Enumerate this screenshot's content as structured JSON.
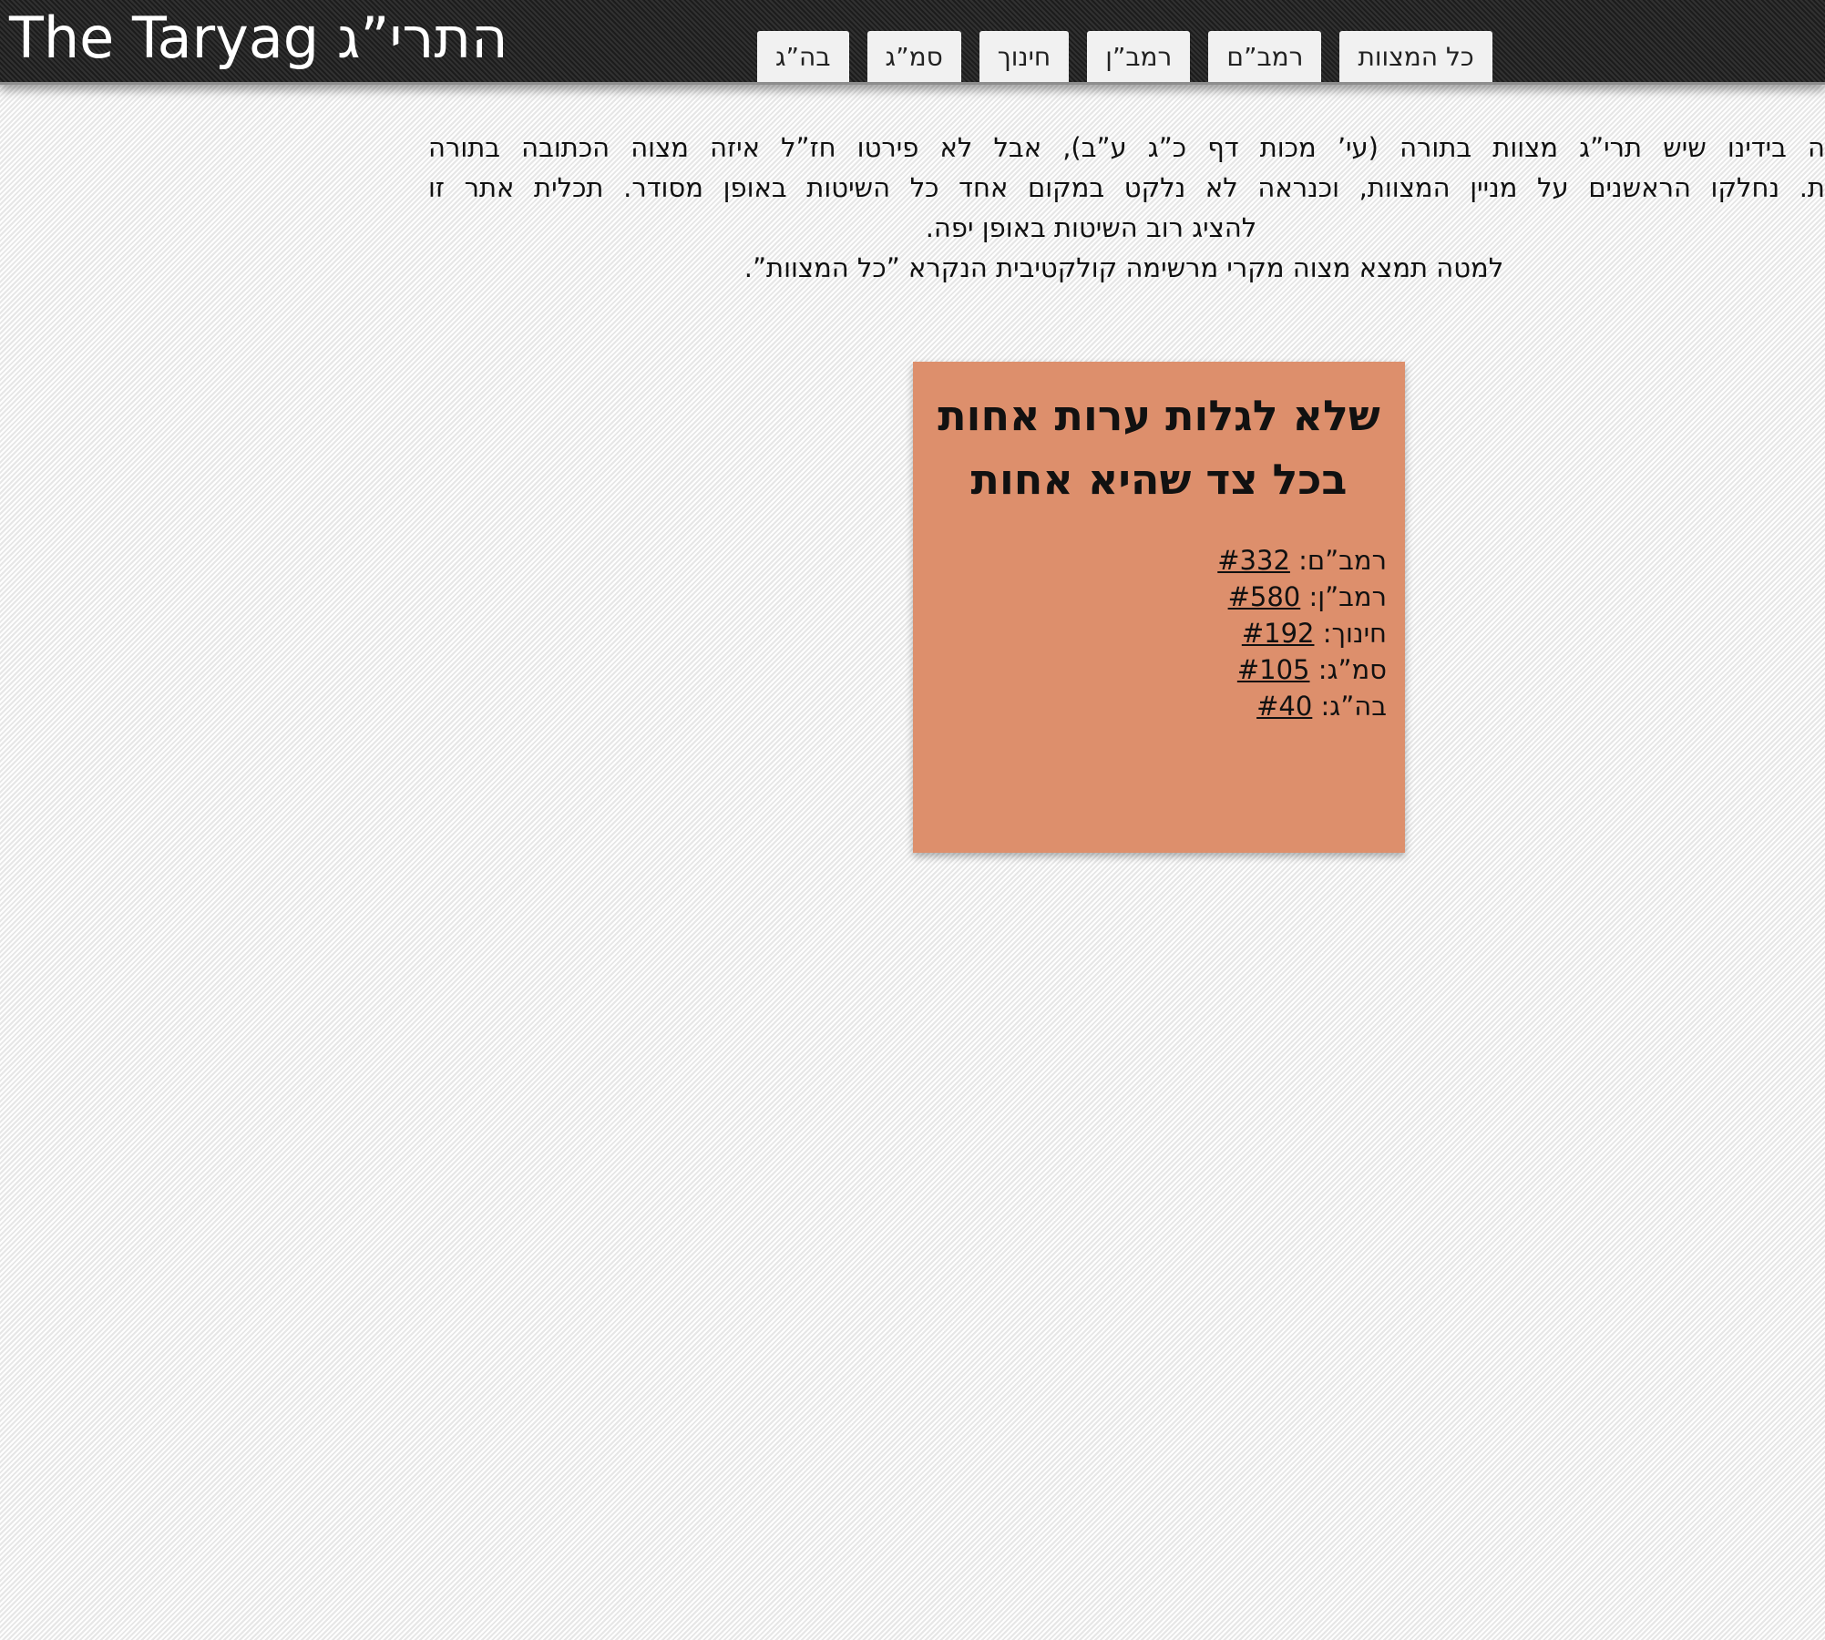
{
  "header": {
    "site_title": "The Taryag התרי”ג",
    "tabs": [
      {
        "label": "כל המצוות"
      },
      {
        "label": "רמב”ם"
      },
      {
        "label": "רמב”ן"
      },
      {
        "label": "חינוך"
      },
      {
        "label": "סמ”ג"
      },
      {
        "label": "בה”ג"
      }
    ]
  },
  "intro": {
    "line1": "ה בידינו שיש תרי”ג מצוות בתורה (עי’ מכות דף כ”ג ע”ב), אבל לא פירטו חז”ל איזה מצוה הכתובה בתורה",
    "line2": "ת. נחלקו הראשנים על מניין המצוות, וכנראה לא נלקט במקום אחד כל השיטות באופן מסודר. תכלית אתר זו",
    "line3": "להציג רוב השיטות באופן יפה.",
    "line4": "למטה תמצא מצוה מקרי מרשימה קולקטיבית הנקרא ”כל המצוות”."
  },
  "mitzvah_card": {
    "title_line1": "שלא לגלות ערות אחות",
    "title_line2": "בכל צד שהיא אחות",
    "references": [
      {
        "source": "רמב”ם:",
        "number": "#332"
      },
      {
        "source": "רמב”ן:",
        "number": "#580"
      },
      {
        "source": "חינוך:",
        "number": "#192"
      },
      {
        "source": "סמ”ג:",
        "number": "#105"
      },
      {
        "source": "בה”ג:",
        "number": "#40"
      }
    ],
    "background_color": "#dd8f6c"
  },
  "colors": {
    "header_bg": "#262626",
    "tab_bg": "#f1f1f1",
    "page_bg": "#f1f1f1"
  }
}
